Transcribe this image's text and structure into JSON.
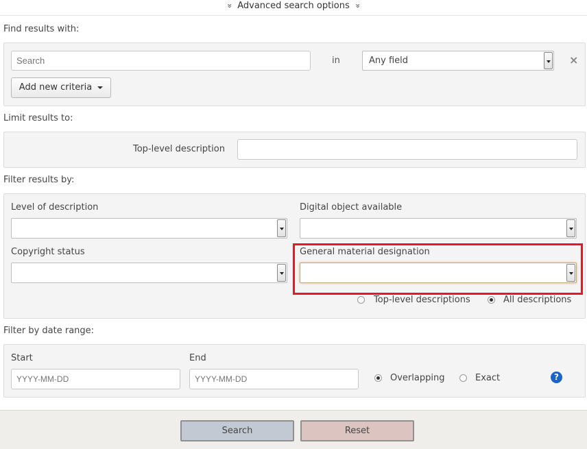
{
  "header": {
    "toggle_label": "Advanced search options",
    "chevron_glyph": "»"
  },
  "find": {
    "section_label": "Find results with:",
    "search_placeholder": "Search",
    "in_label": "in",
    "field_select_value": "Any field",
    "remove_glyph": "×",
    "add_criteria_label": "Add new criteria"
  },
  "limit": {
    "section_label": "Limit results to:",
    "top_level_label": "Top-level description",
    "top_level_value": ""
  },
  "filter": {
    "section_label": "Filter results by:",
    "level_label": "Level of description",
    "level_value": "",
    "digital_label": "Digital object available",
    "digital_value": "",
    "copyright_label": "Copyright status",
    "copyright_value": "",
    "gmd_label": "General material designation",
    "gmd_value": "",
    "radio_top_label": "Top-level descriptions",
    "radio_all_label": "All descriptions",
    "radio_selected": "all"
  },
  "date": {
    "section_label": "Filter by date range:",
    "start_label": "Start",
    "start_placeholder": "YYYY-MM-DD",
    "end_label": "End",
    "end_placeholder": "YYYY-MM-DD",
    "overlapping_label": "Overlapping",
    "exact_label": "Exact",
    "selected": "overlapping",
    "help_glyph": "?"
  },
  "footer": {
    "search_label": "Search",
    "reset_label": "Reset"
  },
  "colors": {
    "highlight": "#dd1c24",
    "search_btn": "#c3c9d3",
    "reset_btn": "#dcc4c0",
    "help": "#1b64c8"
  }
}
